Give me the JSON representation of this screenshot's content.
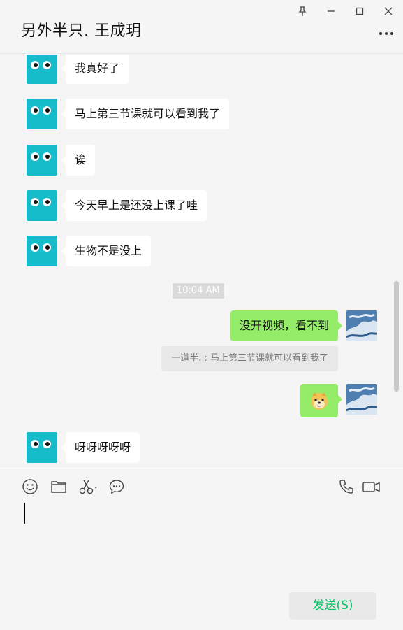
{
  "chat": {
    "title": "另外半只. 王成玥"
  },
  "window": {
    "pin": "pin-icon",
    "minimize": "minimize-icon",
    "maximize": "maximize-icon",
    "close": "close-icon"
  },
  "messages": [
    {
      "dir": "in",
      "text": "我真好了"
    },
    {
      "dir": "in",
      "text": "马上第三节课就可以看到我了"
    },
    {
      "dir": "in",
      "text": "诶"
    },
    {
      "dir": "in",
      "text": "今天早上是还没上课了哇"
    },
    {
      "dir": "in",
      "text": "生物不是没上"
    },
    {
      "type": "time",
      "text": "10:04 AM"
    },
    {
      "dir": "out",
      "text": "没开视频，看不到"
    },
    {
      "type": "quote",
      "text": "一道半. : 马上第三节课就可以看到我了"
    },
    {
      "dir": "out",
      "emoji": "doge-emoji"
    },
    {
      "dir": "in",
      "text": "呀呀呀呀呀"
    }
  ],
  "toolbar": {
    "emoji": "emoji-icon",
    "file": "folder-icon",
    "screenshot": "scissors-icon",
    "chat_history": "chat-bubble-icon",
    "voice_call": "phone-icon",
    "video_call": "video-icon"
  },
  "input": {
    "value": ""
  },
  "send": {
    "label": "发送(S)"
  },
  "colors": {
    "accent": "#07c160",
    "outgoing_bubble": "#95ec69",
    "incoming_bubble": "#ffffff",
    "avatar_teal": "#17bccb",
    "background": "#f5f5f5"
  }
}
